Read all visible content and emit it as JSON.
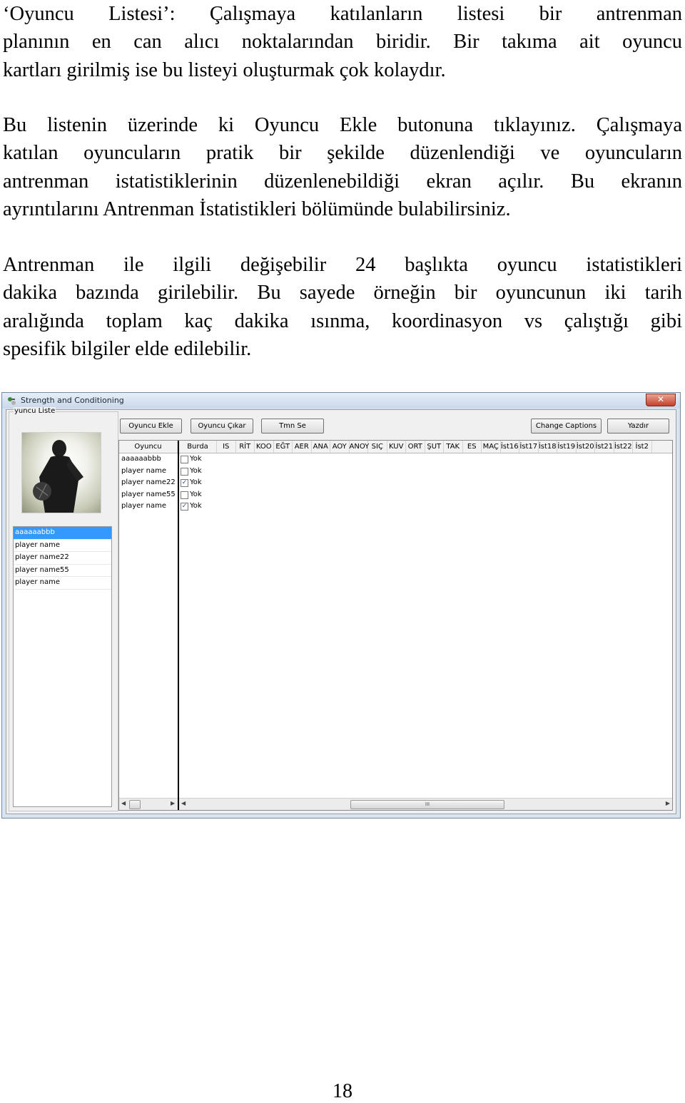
{
  "paragraphs": {
    "p1": [
      "‘Oyuncu Listesi’: Çalışmaya katılanların listesi bir antrenman",
      "planının en can alıcı noktalarından biridir. Bir takıma ait oyuncu",
      "kartları girilmiş ise bu listeyi oluşturmak çok kolaydır."
    ],
    "p2": [
      "Bu listenin üzerinde ki Oyuncu Ekle butonuna tıklayınız. Çalışmaya",
      "katılan oyuncuların pratik bir şekilde düzenlendiği ve oyuncuların",
      "antrenman istatistiklerinin düzenlenebildiği ekran açılır. Bu ekranın",
      "ayrıntılarını Antrenman İstatistikleri bölümünde bulabilirsiniz."
    ],
    "p3": [
      "Antrenman ile ilgili değişebilir 24 başlıkta oyuncu istatistikleri",
      "dakika bazında girilebilir. Bu sayede örneğin bir oyuncunun iki tarih",
      "aralığında toplam kaç dakika ısınma, koordinasyon vs çalıştığı gibi",
      "spesifik bilgiler elde edilebilir."
    ]
  },
  "window": {
    "title": "Strength and Conditioning",
    "close_label": "✕",
    "group_label": "yuncu Liste",
    "player_list": [
      "aaaaaabbb",
      "player name",
      "player name22",
      "player name55",
      "player name"
    ],
    "selected_index": 0,
    "buttons": {
      "add": "Oyuncu Ekle",
      "remove": "Oyuncu Çıkar",
      "tmn": "Tmn Se",
      "captions": "Change Captions",
      "print": "Yazdır"
    },
    "grid": {
      "name_header": "Oyuncu",
      "columns": [
        "Burda",
        "IS",
        "RİT",
        "KOO",
        "EĞT",
        "AER",
        "ANA",
        "AOY",
        "ANOY",
        "SIÇ",
        "KUV",
        "ORT",
        "ŞUT",
        "TAK",
        "ES",
        "MAÇ",
        "İst16",
        "İst17",
        "İst18",
        "İst19",
        "İst20",
        "İst21",
        "İst22",
        "İst2"
      ],
      "rows": [
        {
          "name": "aaaaaabbb",
          "checked": false,
          "status": "Yok"
        },
        {
          "name": "player name",
          "checked": false,
          "status": "Yok"
        },
        {
          "name": "player name22",
          "checked": true,
          "status": "Yok"
        },
        {
          "name": "player name55",
          "checked": false,
          "status": "Yok"
        },
        {
          "name": "player name",
          "checked": true,
          "status": "Yok"
        }
      ],
      "scroll_grip": "III"
    }
  },
  "page_number": "18"
}
